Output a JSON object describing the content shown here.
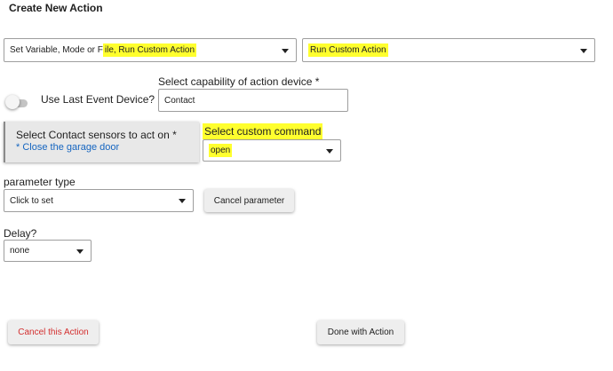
{
  "title": "Create New Action",
  "action_type": {
    "prefix": "Set Variable, Mode or F",
    "highlighted": "ile, Run Custom Action"
  },
  "action_subtype": {
    "value": "Run Custom Action"
  },
  "use_last_event": {
    "label": "Use Last Event Device?",
    "state": "off"
  },
  "capability": {
    "label": "Select capability of action device *",
    "value": "Contact"
  },
  "device_select": {
    "label": "Select Contact sensors to act on *",
    "selected": "* Close the garage door"
  },
  "custom_command": {
    "label": "Select custom command",
    "value": "open"
  },
  "parameter": {
    "label": "parameter type",
    "value": "Click to set",
    "cancel_label": "Cancel parameter"
  },
  "delay": {
    "label": "Delay?",
    "value": "none"
  },
  "footer": {
    "cancel_label": "Cancel this Action",
    "done_label": "Done with Action"
  },
  "colors": {
    "highlight": "#ffff2e",
    "cancel_text": "#d32f2f",
    "link_text": "#1565c0"
  }
}
